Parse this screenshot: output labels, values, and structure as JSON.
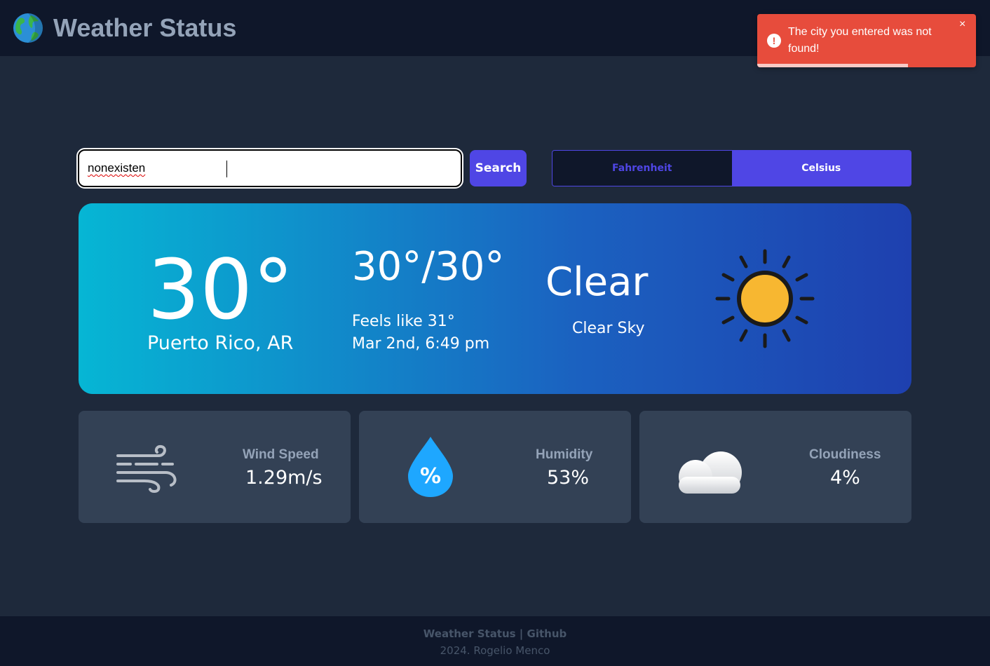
{
  "header": {
    "title": "Weather Status",
    "logo_icon": "globe-icon"
  },
  "toast": {
    "message": "The city you entered was not found!",
    "icon": "alert-circle-icon",
    "close_label": "×",
    "color": "#e74c3c",
    "progress_fraction": 0.69
  },
  "search": {
    "value": "nonexisten",
    "button_label": "Search"
  },
  "units": {
    "options": [
      "Fahrenheit",
      "Celsius"
    ],
    "selected": "Celsius"
  },
  "current": {
    "temperature": "30°",
    "location": "Puerto Rico, AR",
    "hilo": "30°/30°",
    "feels_like": "Feels like 31°",
    "datetime": "Mar 2nd, 6:49 pm",
    "condition": "Clear",
    "description": "Clear Sky",
    "icon": "sun-icon"
  },
  "stats": {
    "wind": {
      "label": "Wind Speed",
      "value": "1.29m/s",
      "icon": "wind-icon"
    },
    "humidity": {
      "label": "Humidity",
      "value": "53%",
      "icon": "humidity-drop-icon"
    },
    "cloudiness": {
      "label": "Cloudiness",
      "value": "4%",
      "icon": "cloud-icon"
    }
  },
  "footer": {
    "line1": "Weather Status | Github",
    "line2": "2024. Rogelio Menco"
  },
  "colors": {
    "accent": "#4f46e5",
    "background": "#1e293b",
    "header": "#0f172a",
    "card": "#334155",
    "sun": "#f7b731"
  }
}
